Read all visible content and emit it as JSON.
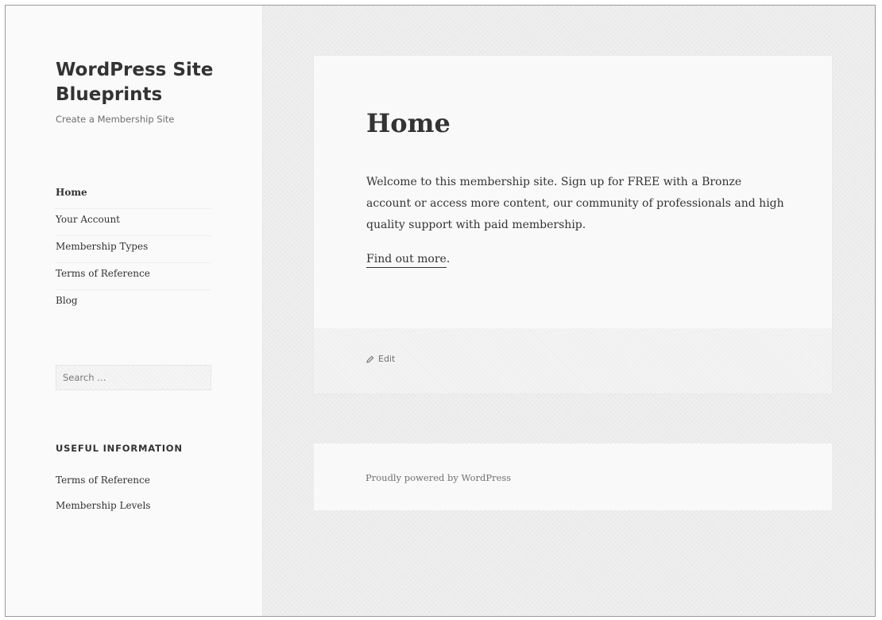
{
  "site": {
    "title": "WordPress Site Blueprints",
    "description": "Create a Membership Site"
  },
  "nav": {
    "items": [
      {
        "label": "Home"
      },
      {
        "label": "Your Account"
      },
      {
        "label": "Membership Types"
      },
      {
        "label": "Terms of Reference"
      },
      {
        "label": "Blog"
      }
    ],
    "current": "Home"
  },
  "search": {
    "placeholder": "Search …"
  },
  "widget": {
    "title": "USEFUL INFORMATION",
    "links": [
      {
        "label": "Terms of Reference"
      },
      {
        "label": "Membership Levels"
      }
    ]
  },
  "article": {
    "title": "Home",
    "body": "Welcome to this membership site. Sign up for FREE with a Bronze account or access more content, our community of professionals and high quality support with paid membership.",
    "link_text": "Find out more",
    "link_suffix": ".",
    "edit_label": "Edit",
    "edit_icon": "pencil-icon"
  },
  "footer": {
    "text": "Proudly powered by WordPress"
  },
  "colors": {
    "text": "#333333",
    "muted": "#707070",
    "sidebar_bg": "#fafafa",
    "page_bg": "#efefef",
    "card_bg": "#f9f9f9"
  }
}
